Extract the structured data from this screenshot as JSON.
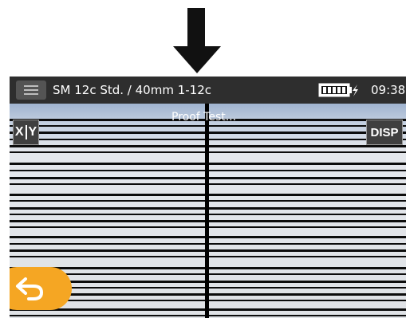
{
  "header": {
    "title": "SM 12c Std. / 40mm 1-12c",
    "time": "09:38"
  },
  "icons": {
    "indicator": "down-arrow-icon",
    "menu": "menu-icon",
    "battery": "battery-charging-icon",
    "back": "back-arrow-icon"
  },
  "view": {
    "status": "Proof Test...",
    "xy_left": "X",
    "xy_right": "Y",
    "disp_label": "DISP"
  },
  "colors": {
    "titlebar": "#2e2e2e",
    "back_button": "#f5a623",
    "fiber": "#0c0c0c"
  }
}
